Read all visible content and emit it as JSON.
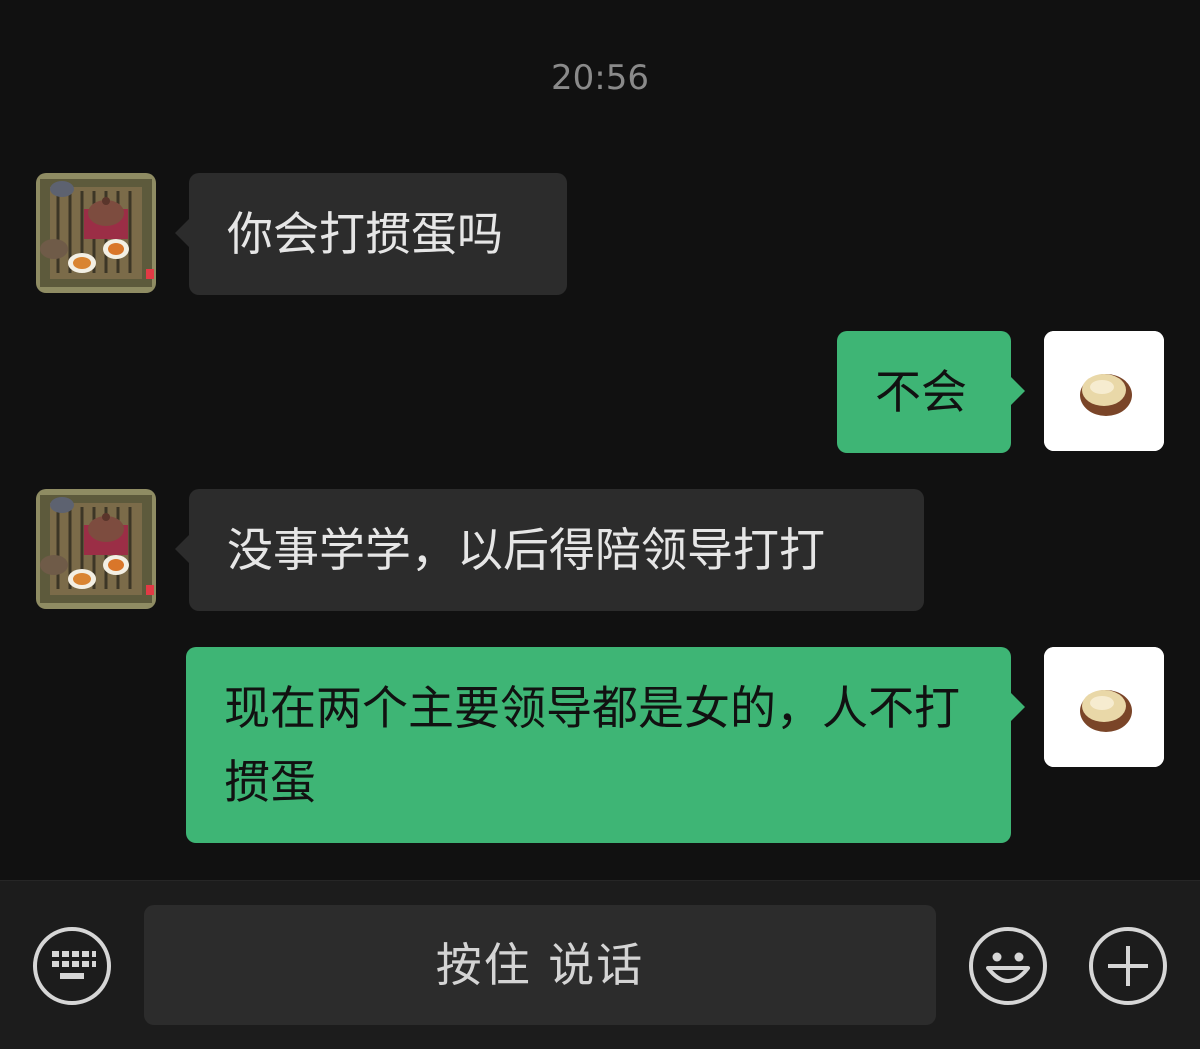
{
  "chat": {
    "timestamp": "20:56",
    "messages": [
      {
        "side": "left",
        "text": "你会打掼蛋吗"
      },
      {
        "side": "right",
        "text": "不会"
      },
      {
        "side": "left",
        "text": "没事学学，以后得陪领导打打"
      },
      {
        "side": "right",
        "text": "现在两个主要领导都是女的，人不打掼蛋"
      }
    ]
  },
  "input_bar": {
    "hold_to_talk_label": "按住 说话",
    "left_icon": "keyboard-icon",
    "right_icons": [
      "emoji-icon",
      "plus-icon"
    ]
  },
  "colors": {
    "background": "#111111",
    "incoming_bubble": "#2c2c2c",
    "outgoing_bubble": "#3eb575",
    "bar": "#1c1c1c"
  }
}
